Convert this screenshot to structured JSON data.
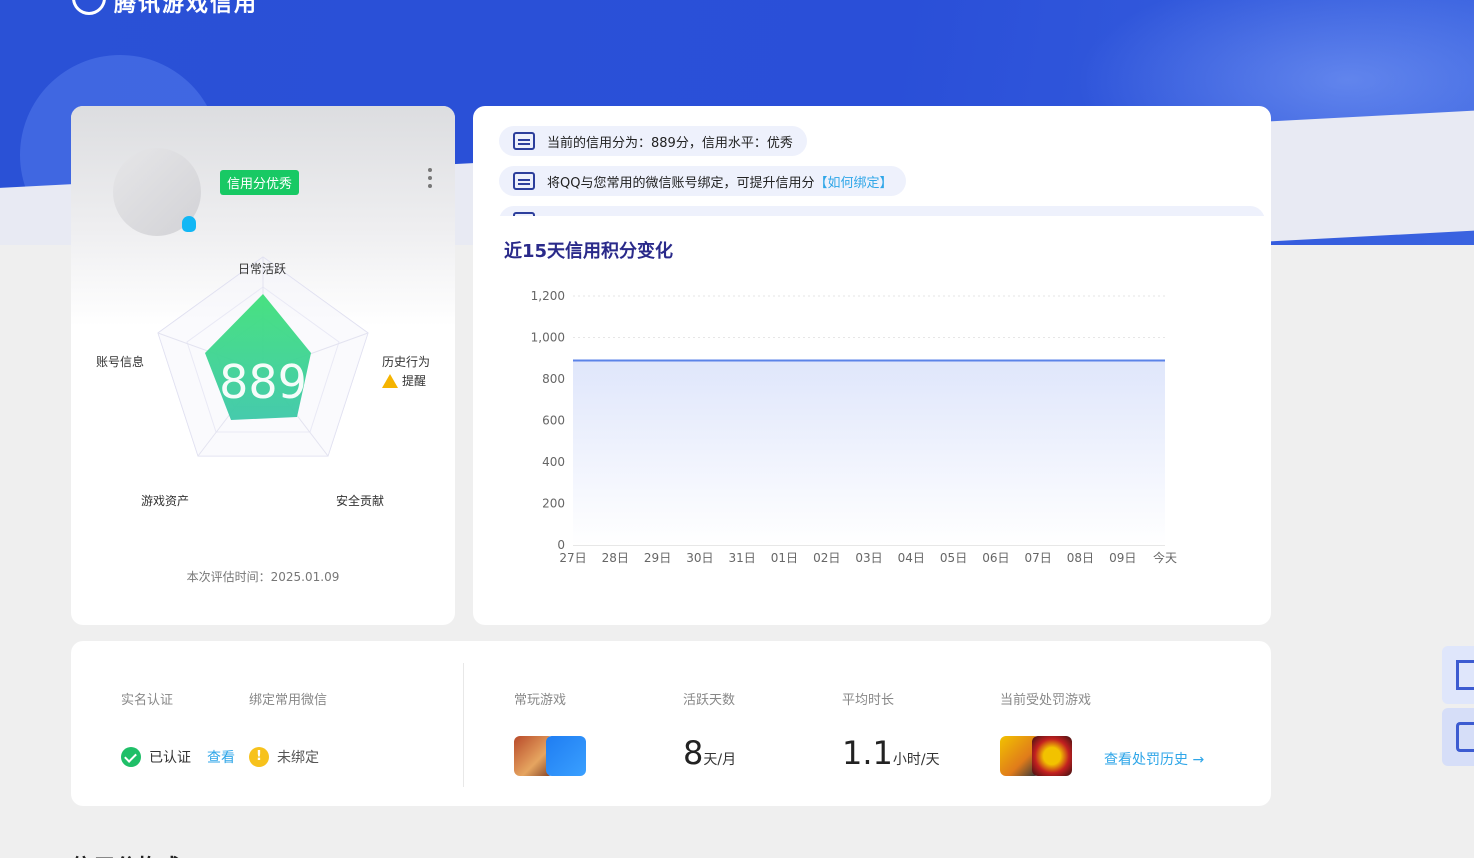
{
  "brand": {
    "title": "腾讯游戏信用"
  },
  "score_card": {
    "level_badge": "信用分优秀",
    "score": "889",
    "radar_labels": {
      "top": "日常活跃",
      "left": "账号信息",
      "right": "历史行为",
      "bottom_left": "游戏资产",
      "bottom_right": "安全贡献"
    },
    "right_alert": "提醒",
    "eval_time": "本次评估时间：2025.01.09"
  },
  "notices": [
    {
      "text": "当前的信用分为：889分，信用水平：优秀",
      "link": ""
    },
    {
      "text": "将QQ与您常用的微信账号绑定，可提升信用分",
      "link": "【如何绑定】"
    }
  ],
  "chart_title": "近15天信用积分变化",
  "chart_data": {
    "type": "area",
    "title": "近15天信用积分变化",
    "categories": [
      "27日",
      "28日",
      "29日",
      "30日",
      "31日",
      "01日",
      "02日",
      "03日",
      "04日",
      "05日",
      "06日",
      "07日",
      "08日",
      "09日",
      "今天"
    ],
    "series": [
      {
        "values": [
          889,
          889,
          889,
          889,
          889,
          889,
          889,
          889,
          889,
          889,
          889,
          889,
          889,
          889,
          889
        ]
      }
    ],
    "ylim": [
      0,
      1200
    ],
    "yticks": [
      0,
      200,
      400,
      600,
      800,
      1000,
      1200
    ],
    "ytick_labels": [
      "0",
      "200",
      "400",
      "600",
      "800",
      "1,000",
      "1,200"
    ],
    "line_color": "#5b83e8",
    "grid": true
  },
  "info": {
    "realname_label": "实名认证",
    "wechat_label": "绑定常用微信",
    "realname_status": "已认证",
    "realname_link": "查看",
    "wechat_status": "未绑定",
    "games_label": "常玩游戏",
    "active_days_label": "活跃天数",
    "active_days_value": "8",
    "active_days_unit": "天/月",
    "avg_time_label": "平均时长",
    "avg_time_value": "1.1",
    "avg_time_unit": "小时/天",
    "penalty_label": "当前受处罚游戏",
    "penalty_link": "查看处罚历史 →"
  },
  "section_title": "信用分构成"
}
